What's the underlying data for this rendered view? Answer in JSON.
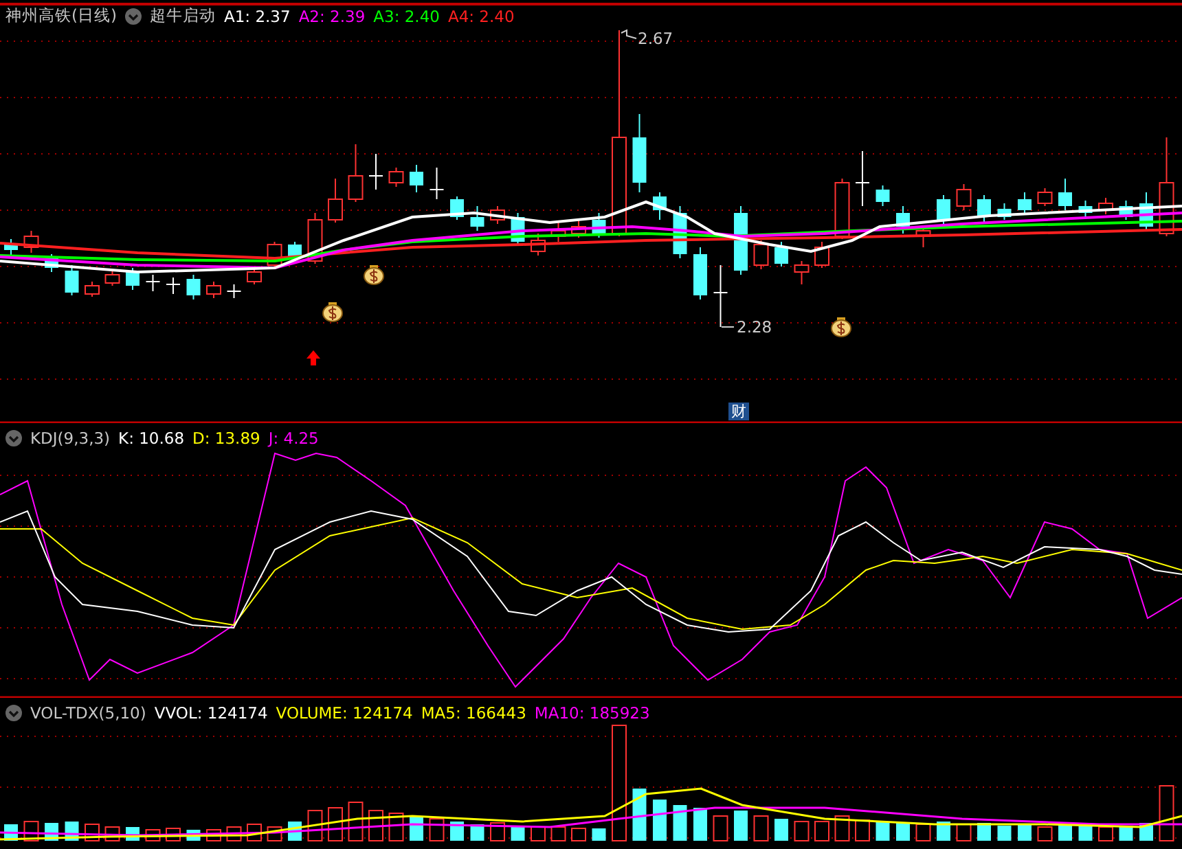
{
  "main_pane": {
    "title": "神州高铁(日线)",
    "indicator": "超牛启动",
    "readings": [
      {
        "label": "A1: 2.37",
        "color": "#ffffff"
      },
      {
        "label": "A2: 2.39",
        "color": "#ff00ff"
      },
      {
        "label": "A3: 2.40",
        "color": "#00ff00"
      },
      {
        "label": "A4: 2.40",
        "color": "#ff2020"
      }
    ],
    "high_label": "2.67",
    "low_label": "2.28",
    "marker": "财"
  },
  "kdj_pane": {
    "title": "KDJ(9,3,3)",
    "readings": [
      {
        "label": "K: 10.68",
        "color": "#ffffff"
      },
      {
        "label": "D: 13.89",
        "color": "#ffff00"
      },
      {
        "label": "J: 4.25",
        "color": "#ff00ff"
      }
    ]
  },
  "vol_pane": {
    "title": "VOL-TDX(5,10)",
    "readings": [
      {
        "label": "VVOL: 124174",
        "color": "#ffffff"
      },
      {
        "label": "VOLUME: 124174",
        "color": "#ffff00"
      },
      {
        "label": "MA5: 166443",
        "color": "#ffff00"
      },
      {
        "label": "MA10: 185923",
        "color": "#ff00ff"
      }
    ]
  }
}
